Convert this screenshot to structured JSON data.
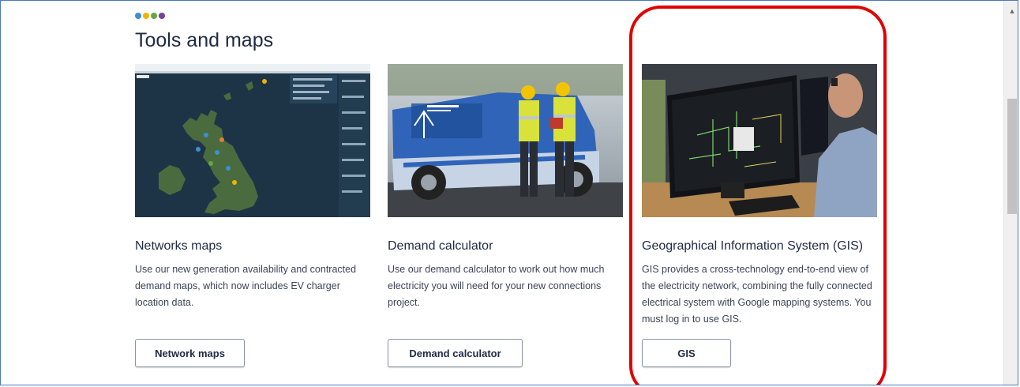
{
  "section": {
    "title": "Tools and maps",
    "dot_colors": [
      "#3f8fd0",
      "#f0b400",
      "#65a83b",
      "#7a3f98"
    ]
  },
  "cards": [
    {
      "title": "Networks maps",
      "description": "Use our new generation availability and contracted demand maps, which now includes EV charger location data.",
      "button_label": "Network maps",
      "image": "network-map-screenshot"
    },
    {
      "title": "Demand calculator",
      "description": "Use our demand calculator to work out how much electricity you will need for your new connections project.",
      "button_label": "Demand calculator",
      "image": "engineers-by-van-photo"
    },
    {
      "title": "Geographical Information System (GIS)",
      "description": "GIS provides a cross-technology end-to-end view of the electricity network, combining the fully connected electrical system with Google mapping systems. You must log in to use GIS.",
      "button_label": "GIS",
      "image": "gis-workstation-photo"
    }
  ],
  "annotation": {
    "highlight_color": "#e00000"
  }
}
